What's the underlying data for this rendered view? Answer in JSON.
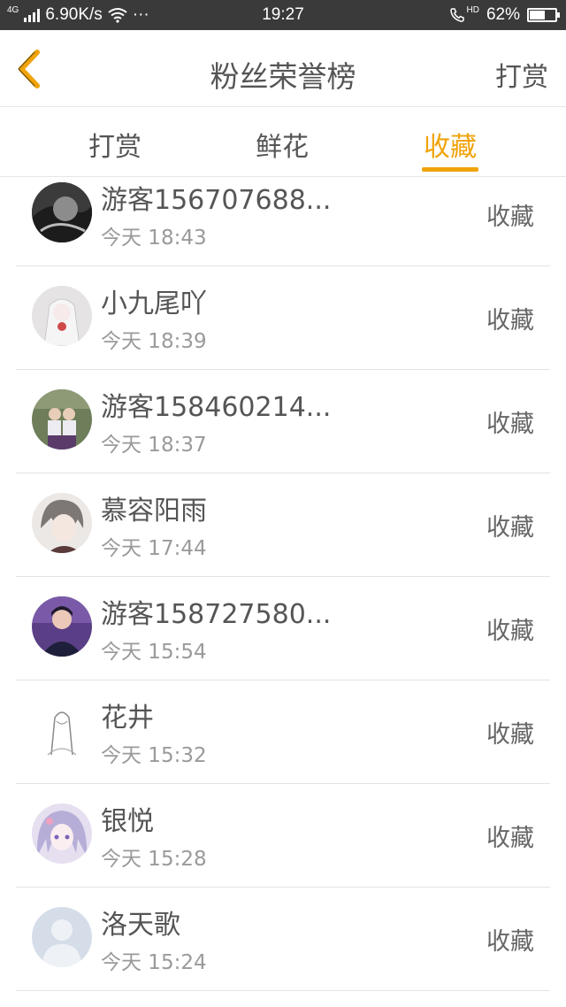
{
  "status_bar": {
    "network": "4G",
    "speed": "6.90K/s",
    "dots": "···",
    "time": "19:27",
    "hd": "HD",
    "battery": "62%",
    "battery_level": 0.62
  },
  "header": {
    "title": "粉丝荣誉榜",
    "action_label": "打赏"
  },
  "tabs": [
    {
      "label": "打赏",
      "active": false
    },
    {
      "label": "鲜花",
      "active": false
    },
    {
      "label": "收藏",
      "active": true
    }
  ],
  "accent_color": "#f0a30a",
  "fans": [
    {
      "name": "游客156707688...",
      "time": "今天 18:43",
      "action": "收藏",
      "avatar": "dark-photo"
    },
    {
      "name": "小九尾吖",
      "time": "今天 18:39",
      "action": "收藏",
      "avatar": "anime-girl-white"
    },
    {
      "name": "游客158460214...",
      "time": "今天 18:37",
      "action": "收藏",
      "avatar": "two-girls-photo"
    },
    {
      "name": "慕容阳雨",
      "time": "今天 17:44",
      "action": "收藏",
      "avatar": "anime-boy"
    },
    {
      "name": "游客158727580...",
      "time": "今天 15:54",
      "action": "收藏",
      "avatar": "purple-photo"
    },
    {
      "name": "花井",
      "time": "今天 15:32",
      "action": "收藏",
      "avatar": "sketch-girl"
    },
    {
      "name": "银悦",
      "time": "今天 15:28",
      "action": "收藏",
      "avatar": "anime-girl-purple"
    },
    {
      "name": "洛天歌",
      "time": "今天 15:24",
      "action": "收藏",
      "avatar": "default-user"
    }
  ]
}
